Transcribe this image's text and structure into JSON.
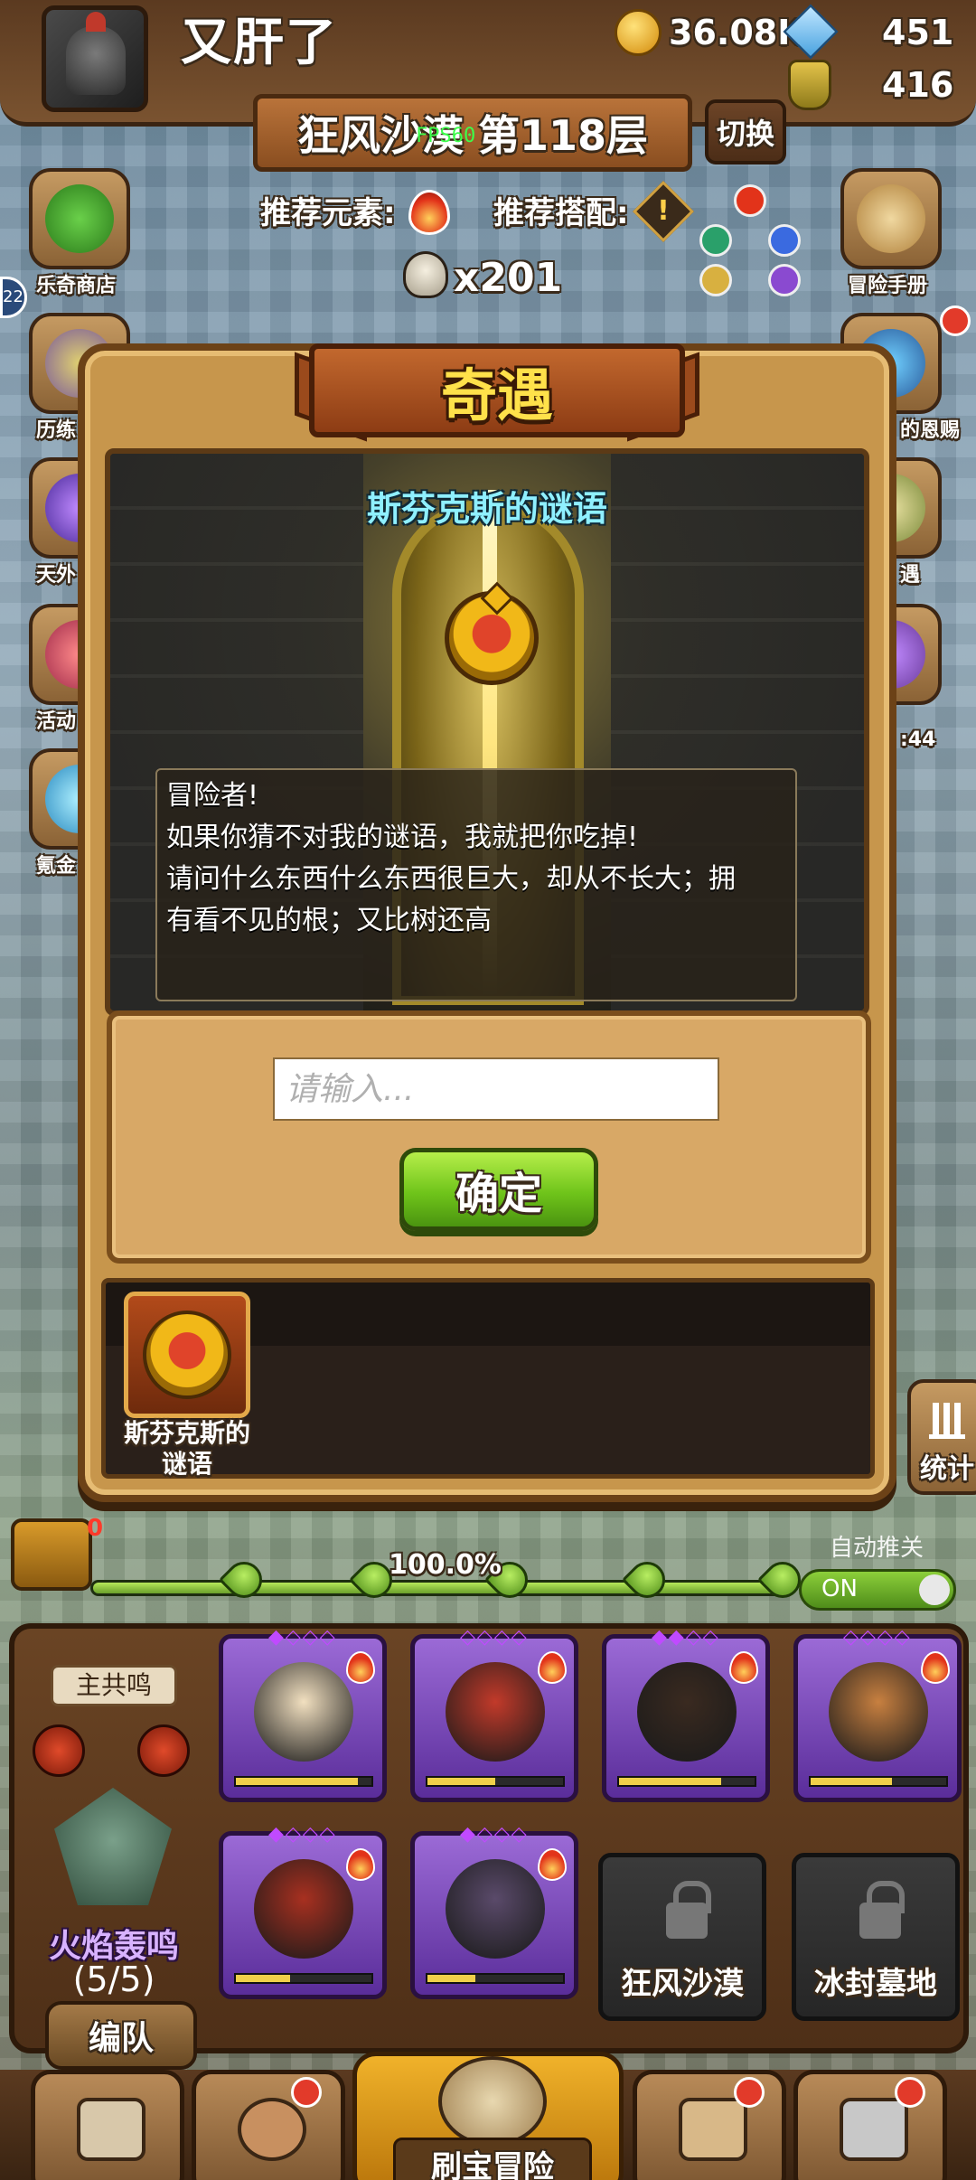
{
  "header": {
    "player_name": "又肝了",
    "gold": "36.08K",
    "gems": "451",
    "potions": "416"
  },
  "stage": {
    "title": "狂风沙漠 第118层",
    "fps": "FPS60",
    "switch_label": "切换",
    "recommend_element_label": "推荐元素:",
    "recommend_combo_label": "推荐搭配:",
    "skull_count": "x201"
  },
  "side_menu": {
    "left": [
      {
        "label": "乐奇商店",
        "icon": "clover-icon"
      },
      {
        "label": "历练",
        "icon": "trophy-icon"
      },
      {
        "label": "天外",
        "icon": "orb-icon"
      },
      {
        "label": "活动",
        "icon": "gift-icon"
      },
      {
        "label": "氪金",
        "icon": "diamond-icon"
      }
    ],
    "right": [
      {
        "label": "冒险手册",
        "icon": "scroll-icon"
      },
      {
        "label": "的恩赐",
        "icon": "blessing-icon"
      },
      {
        "label": "遇",
        "icon": "event-icon"
      },
      {
        "label": ":44",
        "icon": "timer-chest-icon"
      }
    ],
    "left_badge": "22"
  },
  "modal": {
    "title": "奇遇",
    "riddle_title": "斯芬克斯的谜语",
    "dialog_lines": [
      "冒险者!",
      "如果你猜不对我的谜语，我就把你吃掉!",
      "请问什么东西什么东西很巨大，却从不长大；拥",
      "有看不见的根；又比树还高"
    ],
    "input_placeholder": "请输入...",
    "input_value": "",
    "confirm_label": "确定",
    "event_item_label_line1": "斯芬克斯的",
    "event_item_label_line2": "谜语"
  },
  "progress": {
    "chest_count": "0",
    "percent_label": "100.0%",
    "percent_value": 100,
    "auto_push_label": "自动推关",
    "auto_push_state": "ON"
  },
  "stats_label": "统计",
  "team": {
    "leader_tag": "主共鸣",
    "name": "火焰轰鸣",
    "count": "(5/5)",
    "formation_label": "编队",
    "heroes": [
      {
        "name": "king-hero",
        "stars": 1,
        "hp": 0.9,
        "color": "#f2e0c0"
      },
      {
        "name": "devil-hero",
        "stars": 0,
        "hp": 0.5,
        "color": "#c23a2a"
      },
      {
        "name": "bomber-hero",
        "stars": 2,
        "hp": 0.75,
        "color": "#3a2a20"
      },
      {
        "name": "turban-hero",
        "stars": 0,
        "hp": 0.6,
        "color": "#c88040"
      },
      {
        "name": "oni-hero",
        "stars": 1,
        "hp": 0.4,
        "color": "#a83020"
      },
      {
        "name": "pirate-hero",
        "stars": 1,
        "hp": 0.35,
        "color": "#5a4a6a"
      }
    ],
    "locked_slots": [
      "狂风沙漠",
      "冰封墓地"
    ]
  },
  "bottom_nav": {
    "main_label": "刷宝冒险",
    "items": [
      "shop-icon",
      "hero-icon",
      "bag-icon",
      "forge-icon"
    ]
  },
  "colors": {
    "fire": "#e2331a",
    "title_gold": "#ffe14a",
    "riddle_cyan": "#8ff0ff",
    "confirm_green": "#6fc41a"
  }
}
